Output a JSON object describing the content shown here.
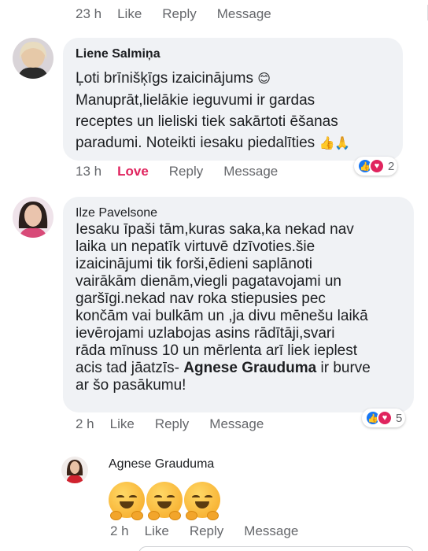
{
  "top_actions": {
    "time": "23 h",
    "like": "Like",
    "reply": "Reply",
    "message": "Message"
  },
  "comments": [
    {
      "author": "Liene Salmiņa",
      "lines": [
        "Ļoti brīnišķīgs izaicinājums",
        "Manuprāt,lielākie ieguvumi ir gardas",
        "receptes  un lieliski tiek sakārtoti ēšanas",
        "paradumi. Noteikti iesaku piedalīties"
      ],
      "emoji_after_line1": "😊",
      "emoji_after_line4": "👍🙏",
      "reactions": {
        "icons": [
          "like-icon",
          "love-icon"
        ],
        "count": "2"
      },
      "actions": {
        "time": "13 h",
        "like": "Love",
        "reply": "Reply",
        "message": "Message"
      }
    },
    {
      "author": "Ilze Pavelsone",
      "lines": [
        "Iesaku īpaši tām,kuras saka,ka nekad nav",
        "laika un nepatīk virtuvē dzīvoties.šie",
        "izaicinājumi tik forši,ēdieni saplānoti",
        "vairākām dienām,viegli pagatavojami un",
        "garšīgi.nekad nav roka stiepusies pec",
        "končām vai bulkām un ,ja divu mēnešu laikā",
        "ievērojami  uzlabojas asins rādītāji,svari",
        "rāda mīnuss 10 un mērlenta arī liek ieplest",
        "acis tad jāatzīs-",
        "ir burve",
        "ar šo pasākumu!"
      ],
      "mention": "Agnese Grauduma",
      "reactions": {
        "icons": [
          "like-icon",
          "love-icon"
        ],
        "count": "5"
      },
      "actions": {
        "time": "2 h",
        "like": "Like",
        "reply": "Reply",
        "message": "Message"
      }
    },
    {
      "author": "Agnese Grauduma",
      "emoji_count": 3,
      "emoji_name": "hugging-face",
      "actions": {
        "time": "2 h",
        "like": "Like",
        "reply": "Reply",
        "message": "Message"
      }
    }
  ],
  "colors": {
    "bubble": "#f0f2f5",
    "love": "#e0245e",
    "like_blue": "#1877f2",
    "meta": "#65676b"
  }
}
